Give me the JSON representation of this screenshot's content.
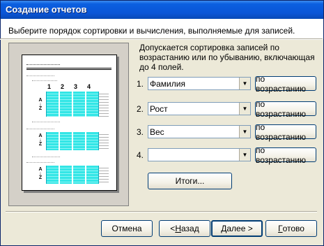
{
  "window": {
    "title": "Создание отчетов"
  },
  "header": {
    "instruction": "Выберите порядок сортировки и вычисления, выполняемые для записей."
  },
  "description": "Допускается сортировка записей по возрастанию или по убыванию, включающая до 4 полей.",
  "preview": {
    "placeholder": "xxxxxxxxxx",
    "column_numbers": [
      "1",
      "2",
      "3",
      "4"
    ],
    "sort_glyph_top": "A",
    "sort_glyph_bottom": "Z"
  },
  "sort_fields": [
    {
      "number": "1.",
      "value": "Фамилия",
      "order": "по возрастанию"
    },
    {
      "number": "2.",
      "value": "Рост",
      "order": "по возрастанию"
    },
    {
      "number": "3.",
      "value": "Вес",
      "order": "по возрастанию"
    },
    {
      "number": "4.",
      "value": "",
      "order": "по возрастанию"
    }
  ],
  "summary_button": {
    "label": "Итоги..."
  },
  "footer": {
    "cancel": "Отмена",
    "back_prefix": "< ",
    "back_hotkey": "Н",
    "back_rest": "азад",
    "next_hotkey": "Д",
    "next_rest": "алее >",
    "finish_hotkey": "Г",
    "finish_rest": "отово"
  },
  "colors": {
    "title_bar": "#0a55d6",
    "preview_highlight": "#33e6e6",
    "dialog_bg": "#ece9d8"
  },
  "icons": [
    "dropdown-arrow-icon"
  ]
}
